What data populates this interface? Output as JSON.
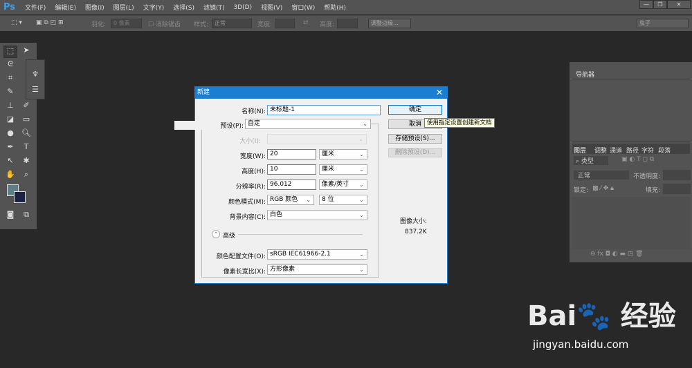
{
  "app": {
    "logo": "Ps"
  },
  "menu": [
    "文件(F)",
    "编辑(E)",
    "图像(I)",
    "图层(L)",
    "文字(Y)",
    "选择(S)",
    "滤镜(T)",
    "3D(D)",
    "视图(V)",
    "窗口(W)",
    "帮助(H)"
  ],
  "window_controls": {
    "minimize": "—",
    "restore": "❐",
    "close": "✕"
  },
  "options": {
    "feather_label": "羽化:",
    "feather_value": "0 像素",
    "antialias": "消除锯齿",
    "style_label": "样式:",
    "style_value": "正常",
    "width_label": "宽度:",
    "height_label": "高度:",
    "refine_edge": "调整边缘...",
    "workspace": "虫子"
  },
  "panels": {
    "navigator": "导航器",
    "tabs": [
      "图层",
      "调整",
      "通道",
      "路径",
      "字符",
      "段落"
    ],
    "filter_kind": "类型",
    "blend_mode": "正常",
    "opacity_label": "不透明度:",
    "lock_label": "锁定:",
    "fill_label": "填充:"
  },
  "dialog": {
    "title": "新建",
    "name_label": "名称(N):",
    "name_value": "未标题-1",
    "preset_label": "预设(P):",
    "preset_value": "自定",
    "size_label": "大小(I):",
    "width_label": "宽度(W):",
    "width_value": "20",
    "width_unit": "厘米",
    "height_label": "高度(H):",
    "height_value": "10",
    "height_unit": "厘米",
    "resolution_label": "分辨率(R):",
    "resolution_value": "96.012",
    "resolution_unit": "像素/英寸",
    "color_mode_label": "颜色模式(M):",
    "color_mode_value": "RGB 颜色",
    "bit_depth": "8 位",
    "background_label": "背景内容(C):",
    "background_value": "白色",
    "advanced_label": "高级",
    "profile_label": "颜色配置文件(O):",
    "profile_value": "sRGB IEC61966-2.1",
    "aspect_label": "像素长宽比(X):",
    "aspect_value": "方形像素",
    "ok": "确定",
    "cancel": "取消",
    "save_preset": "存储预设(S)...",
    "delete_preset": "删除预设(D)...",
    "image_size_label": "图像大小:",
    "image_size_value": "837.2K",
    "tooltip": "使用指定设置创建新文档"
  },
  "watermark": {
    "text": "Bai du 经验",
    "url": "jingyan.baidu.com"
  }
}
